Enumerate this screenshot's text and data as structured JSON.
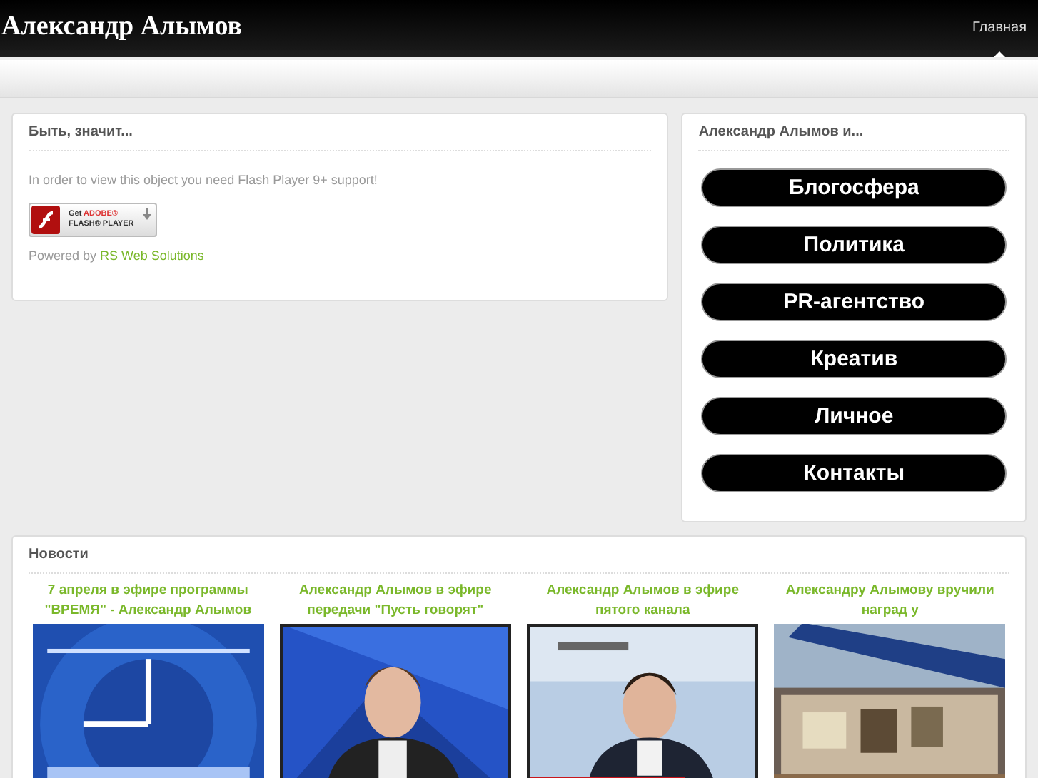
{
  "header": {
    "site_title": "Александр Алымов",
    "nav": [
      {
        "label": "Главная",
        "selected": true
      }
    ]
  },
  "main_panel": {
    "title": "Быть, значит...",
    "message": "In order to view this object you need Flash Player 9+ support!",
    "flash_badge": {
      "prefix": "Get",
      "brand": "ADOBE®",
      "product": "FLASH® PLAYER"
    },
    "powered_by": "Powered by",
    "powered_link": "RS Web Solutions"
  },
  "side_panel": {
    "title": "Александр Алымов и...",
    "links": [
      "Блогосфера",
      "Политика",
      "PR-агентство",
      "Креатив",
      "Личное",
      "Контакты"
    ]
  },
  "news": {
    "title": "Новости",
    "items": [
      {
        "title": "7 апреля в эфире программы \"ВРЕМЯ\" - Александр Алымов",
        "framed": false,
        "kind": "picture"
      },
      {
        "title": "Александр Алымов в эфире передачи \"Пусть говорят\"",
        "framed": true,
        "kind": "picture"
      },
      {
        "title": "Александр Алымов в эфире пятого канала",
        "framed": true,
        "kind": "picture"
      },
      {
        "title": "Александру Алымову вручили наград у",
        "framed": false,
        "kind": "picture"
      }
    ]
  }
}
